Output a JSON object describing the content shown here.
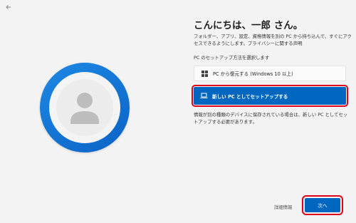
{
  "nav": {
    "back_icon": "back-arrow-icon"
  },
  "avatar": {
    "icon": "user-avatar-icon",
    "accent": "#0b6fd6"
  },
  "content": {
    "title": "こんにちは、一郎 さん。",
    "description": "フォルダー、アプリ、設定、資格情報を別の PC から持ち込んで、すぐにアクセスできるようにします。プライバシーに関する声明",
    "section_label": "PC のセットアップ方法を選択します",
    "options": [
      {
        "label": "PC から復元する (Windows 10 以上)",
        "icon": "windows-icon",
        "selected": false
      },
      {
        "label": "新しい PC としてセットアップする",
        "icon": "laptop-icon",
        "selected": true
      }
    ],
    "info_text": "情報が別の種類のデバイスに保存されている場合は、新しい PC としてセットアップする必要があります。"
  },
  "footer": {
    "details_label": "詳細情報",
    "next_label": "次へ"
  },
  "colors": {
    "primary": "#0067c0",
    "highlight": "#e0001b",
    "background": "#f3f3f3"
  }
}
